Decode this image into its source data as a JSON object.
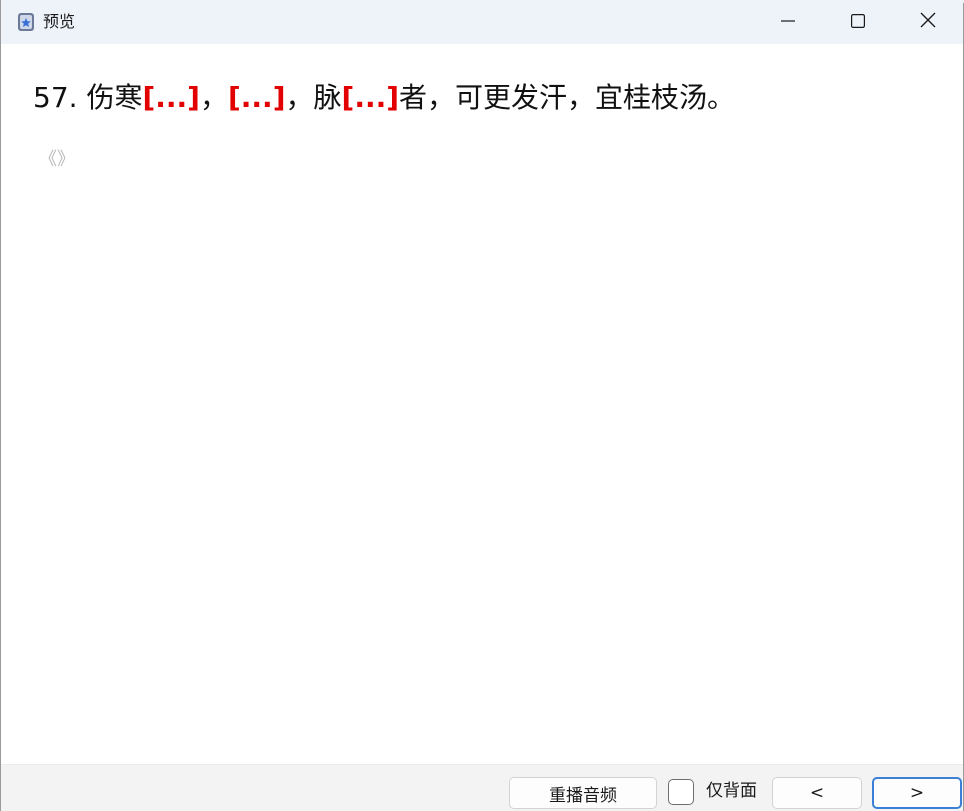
{
  "window": {
    "title": "预览",
    "icons": [
      "app-icon",
      "minimize-icon",
      "maximize-icon",
      "close-icon"
    ]
  },
  "card": {
    "number": "57.",
    "parts": {
      "p1": "伤寒",
      "c1": "[...]",
      "s1": "，",
      "c2": "[...]",
      "s2": "，脉",
      "c3": "[...]",
      "p2": "者，可更发汗，宜桂枝汤。"
    },
    "sub": "《》"
  },
  "footer": {
    "replay_label": "重播音频",
    "back_only_label": "仅背面",
    "prev_label": "<",
    "next_label": ">"
  },
  "colors": {
    "cloze": "#e20000",
    "titlebar": "#eef3fa",
    "footer": "#f3f3f3",
    "focus_border": "#3b7fd6"
  }
}
